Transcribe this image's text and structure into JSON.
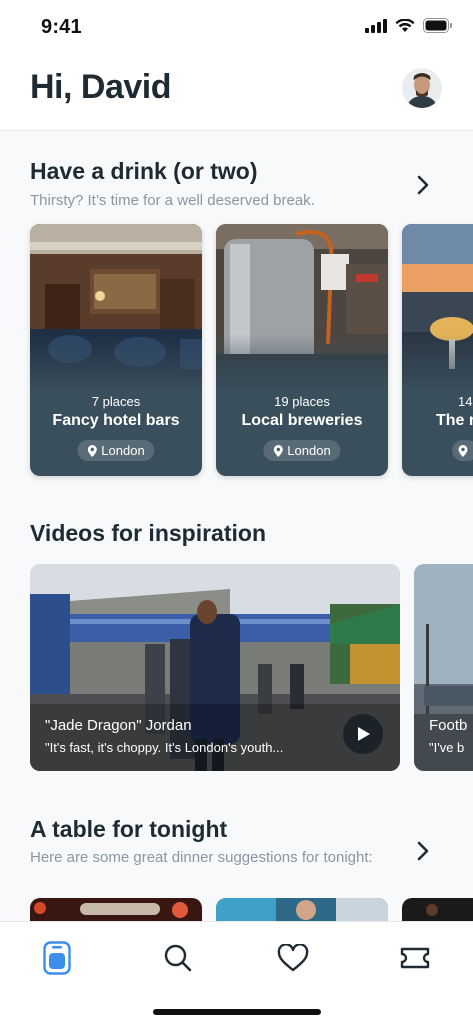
{
  "status_bar": {
    "time": "9:41"
  },
  "header": {
    "greeting": "Hi, David"
  },
  "sections": {
    "drinks": {
      "title": "Have a drink (or two)",
      "subtitle": "Thirsty? It’s time for a well deserved break.",
      "cards": [
        {
          "count": "7 places",
          "title": "Fancy hotel bars",
          "location": "London"
        },
        {
          "count": "19 places",
          "title": "Local breweries",
          "location": "London"
        },
        {
          "count": "14",
          "title": "The r",
          "location": ""
        }
      ]
    },
    "videos": {
      "title": "Videos for inspiration",
      "items": [
        {
          "title": "\"Jade Dragon\" Jordan",
          "quote": "\"It's fast, it's choppy. It's London's youth..."
        },
        {
          "title": "Footb",
          "quote": "\"I've b"
        }
      ]
    },
    "dinner": {
      "title": "A table for tonight",
      "subtitle": "Here are some great dinner suggestions for tonight:"
    }
  },
  "tabbar": {
    "items": [
      {
        "name": "home",
        "icon": "home-icon",
        "active": true
      },
      {
        "name": "search",
        "icon": "search-icon",
        "active": false
      },
      {
        "name": "favorites",
        "icon": "heart-icon",
        "active": false
      },
      {
        "name": "tickets",
        "icon": "ticket-icon",
        "active": false
      }
    ]
  },
  "colors": {
    "accent": "#3b8eea",
    "card_bg": "#3a4f5c",
    "title": "#1f2b33",
    "subtitle": "#8a96a0"
  }
}
